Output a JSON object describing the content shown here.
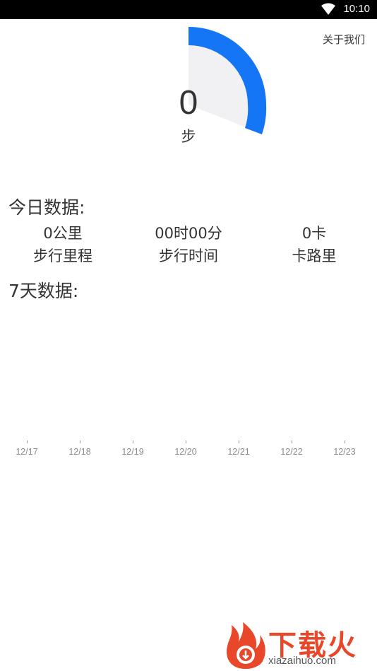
{
  "status_bar": {
    "time": "10:10",
    "icons": [
      "wifi-icon"
    ]
  },
  "header": {
    "about_label": "关于我们"
  },
  "gauge": {
    "steps": "0",
    "unit": "步",
    "progress_fraction": 0.31,
    "color_fill": "#1476f5",
    "color_track": "#f1f1f3"
  },
  "today": {
    "title": "今日数据:",
    "stats": [
      {
        "value": "0公里",
        "label": "步行里程"
      },
      {
        "value": "00时00分",
        "label": "步行时间"
      },
      {
        "value": "0卡",
        "label": "卡路里"
      }
    ]
  },
  "week": {
    "title": "7天数据:",
    "chart_data": {
      "type": "bar",
      "categories": [
        "12/17",
        "12/18",
        "12/19",
        "12/20",
        "12/21",
        "12/22",
        "12/23"
      ],
      "values": [
        0,
        0,
        0,
        0,
        0,
        0,
        0
      ]
    }
  },
  "watermark": {
    "text": "下载火",
    "url": "xiazaihuo.com",
    "brand_color": "#e8472a"
  }
}
